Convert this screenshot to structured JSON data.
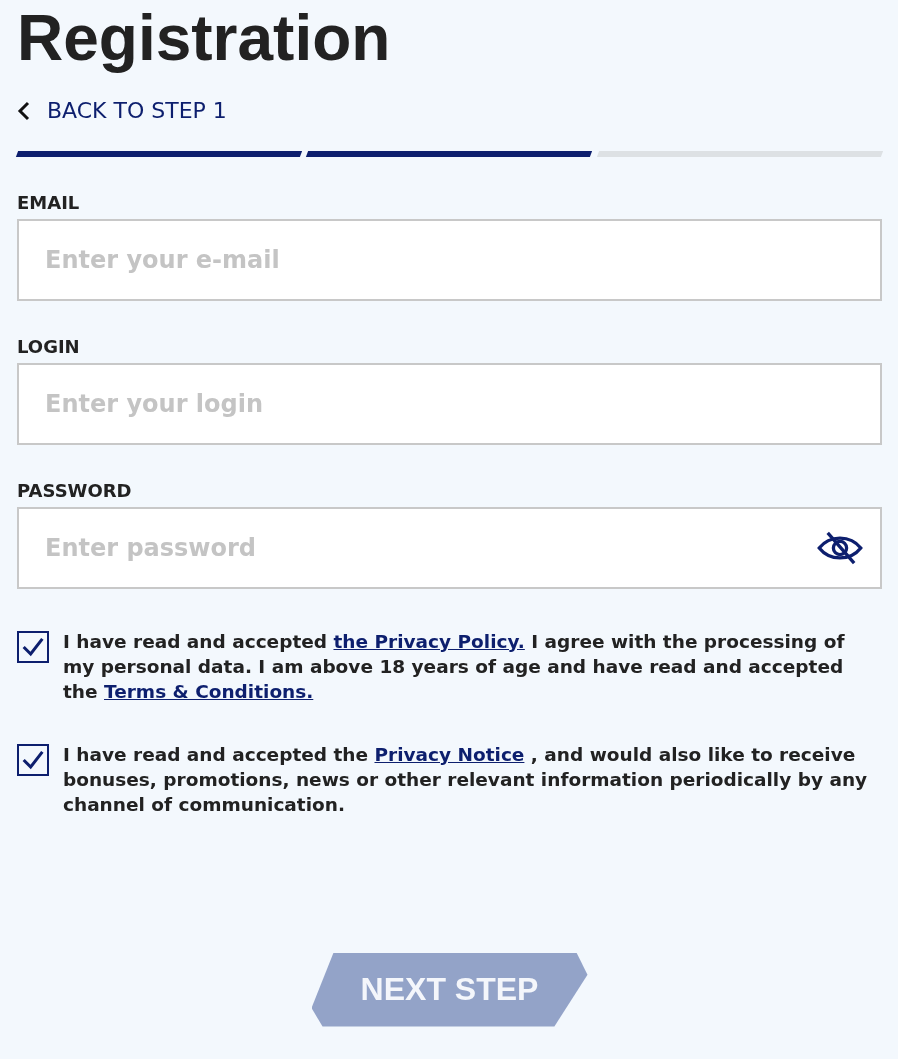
{
  "title": "Registration",
  "back_link": {
    "label": "BACK TO STEP 1"
  },
  "progress": [
    {
      "done": true
    },
    {
      "done": true
    },
    {
      "done": false
    }
  ],
  "fields": [
    {
      "kind": "text",
      "label": "EMAIL",
      "placeholder": "Enter your e-mail"
    },
    {
      "kind": "text",
      "label": "LOGIN",
      "placeholder": "Enter your login"
    },
    {
      "kind": "password",
      "label": "PASSWORD",
      "placeholder": "Enter password",
      "visible": false
    }
  ],
  "consents": [
    {
      "checked": true,
      "parts": [
        {
          "kind": "text",
          "text": "I have read and accepted "
        },
        {
          "kind": "link",
          "text": "the Privacy Policy."
        },
        {
          "kind": "text",
          "text": " I agree with the processing of my personal data. I am above 18 years of age and have read and accepted the "
        },
        {
          "kind": "link",
          "text": "Terms & Conditions."
        }
      ]
    },
    {
      "checked": true,
      "parts": [
        {
          "kind": "text",
          "text": "I have read and accepted the "
        },
        {
          "kind": "link",
          "text": "Privacy Notice"
        },
        {
          "kind": "text",
          "text": " , and would also like to receive bonuses, promotions, news or other relevant information periodically by any channel of communication."
        }
      ]
    }
  ],
  "next_button": {
    "label": "NEXT STEP",
    "disabled": true
  }
}
